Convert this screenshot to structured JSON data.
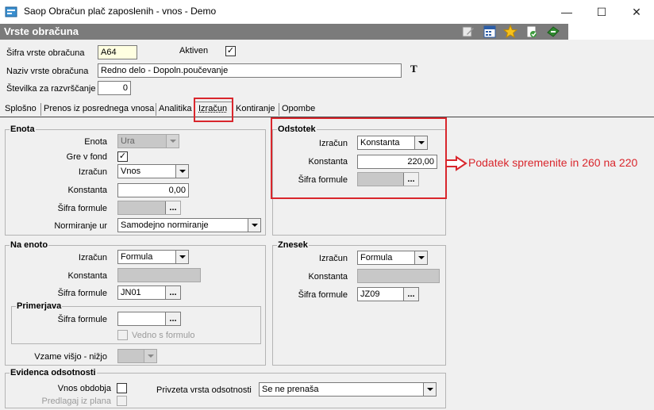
{
  "window": {
    "title": "Saop Obračun plač zaposlenih - vnos - Demo",
    "minimize_glyph": "—",
    "maximize_glyph": "☐",
    "close_glyph": "✕"
  },
  "header": {
    "title": "Vrste obračuna"
  },
  "toolbar": {
    "icons": [
      "edit-icon",
      "calculator-icon",
      "star-icon",
      "refresh-icon",
      "exit-icon"
    ]
  },
  "top": {
    "sifra_label": "Šifra vrste obračuna",
    "sifra_value": "A64",
    "aktiven_label": "Aktiven",
    "aktiven_checked": "✓",
    "naziv_label": "Naziv vrste obračuna",
    "naziv_value": "Redno delo - Dopoln.poučevanje",
    "font_button_glyph": "T",
    "stevilka_label": "Številka  za razvrščanje",
    "stevilka_value": "0"
  },
  "tabs": [
    {
      "label": "Splošno"
    },
    {
      "label": "Prenos iz posrednega vnosa"
    },
    {
      "label": "Analitika"
    },
    {
      "label": "Izračun"
    },
    {
      "label": "Kontiranje"
    },
    {
      "label": "Opombe"
    }
  ],
  "enota": {
    "title": "Enota",
    "enota_label": "Enota",
    "enota_value": "Ura",
    "gre_v_fond_label": "Gre v fond",
    "gre_v_fond_checked": "✓",
    "izracun_label": "Izračun",
    "izracun_value": "Vnos",
    "konstanta_label": "Konstanta",
    "konstanta_value": "0,00",
    "sifra_formule_label": "Šifra formule",
    "sifra_formule_value": "",
    "normiranje_label": "Normiranje ur",
    "normiranje_value": "Samodejno normiranje"
  },
  "odstotek": {
    "title": "Odstotek",
    "izracun_label": "Izračun",
    "izracun_value": "Konstanta",
    "konstanta_label": "Konstanta",
    "konstanta_value": "220,00",
    "sifra_formule_label": "Šifra formule",
    "sifra_formule_value": ""
  },
  "na_enoto": {
    "title": "Na enoto",
    "izracun_label": "Izračun",
    "izracun_value": "Formula",
    "konstanta_label": "Konstanta",
    "konstanta_value": "",
    "sifra_formule_label": "Šifra formule",
    "sifra_formule_value": "JN01",
    "primerjava_title": "Primerjava",
    "primerjava_sifra_label": "Šifra formule",
    "primerjava_sifra_value": "",
    "vedno_s_formulo_label": "Vedno s formulo",
    "vzame_label": "Vzame višjo - nižjo",
    "vzame_value": ""
  },
  "znesek": {
    "title": "Znesek",
    "izracun_label": "Izračun",
    "izracun_value": "Formula",
    "konstanta_label": "Konstanta",
    "konstanta_value": "",
    "sifra_formule_label": "Šifra formule",
    "sifra_formule_value": "JZ09"
  },
  "evidenca": {
    "title": "Evidenca odsotnosti",
    "vnos_obdobja_label": "Vnos obdobja",
    "predlagaj_label": "Predlagaj iz plana",
    "privzeta_label": "Privzeta vrsta odsotnosti",
    "privzeta_value": "Se ne prenaša"
  },
  "dots_glyph": "...",
  "annotation": {
    "text": "Podatek spremenite in 260 na 220",
    "color": "#d9262c"
  }
}
